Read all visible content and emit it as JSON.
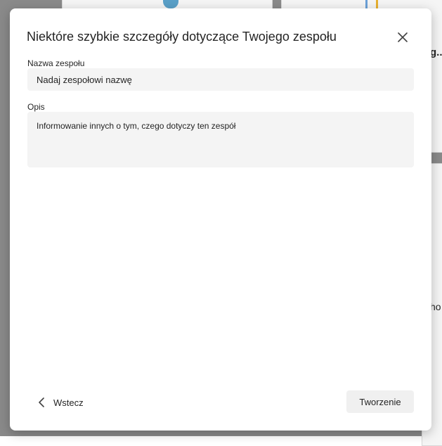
{
  "background": {
    "truncated_heading": "g...",
    "truncated_text": "ho"
  },
  "dialog": {
    "title": "Niektóre szybkie szczegóły dotyczące Twojego zespołu",
    "close_icon": "close-icon",
    "fields": {
      "name": {
        "label": "Nazwa zespołu",
        "placeholder": "Nadaj zespołowi nazwę",
        "value": ""
      },
      "description": {
        "label": "Opis",
        "placeholder": "Informowanie innych o tym, czego dotyczy ten zespół",
        "value": ""
      }
    },
    "footer": {
      "back_label": "Wstecz",
      "back_icon": "chevron-left-icon",
      "create_label": "Tworzenie"
    }
  },
  "colors": {
    "overlay": "#8a8a8a",
    "dialog_bg": "#ffffff",
    "input_bg": "#f4f4f4",
    "text": "#242424",
    "button_bg": "#f0f0f0"
  }
}
